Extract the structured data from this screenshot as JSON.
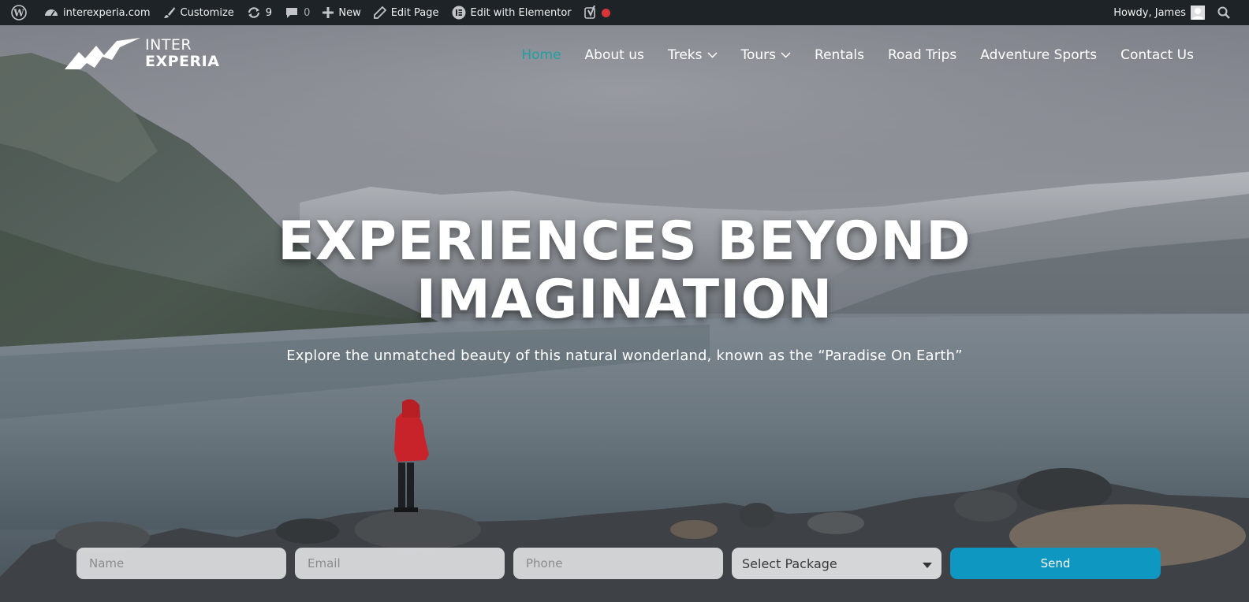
{
  "admin_bar": {
    "site_name": "interexperia.com",
    "customize": "Customize",
    "updates_count": "9",
    "comments_count": "0",
    "new_label": "New",
    "edit_page": "Edit Page",
    "edit_elementor": "Edit with Elementor",
    "greeting": "Howdy, James",
    "icons": [
      "wordpress-icon",
      "dashboard-icon",
      "brush-icon",
      "refresh-icon",
      "comment-icon",
      "plus-icon",
      "pencil-icon",
      "elementor-icon",
      "yoast-icon",
      "status-dot-icon",
      "avatar",
      "search-icon"
    ],
    "status_color": "#d63638"
  },
  "brand": {
    "line1": "INTER",
    "line2": "EXPERIA"
  },
  "nav": {
    "items": [
      {
        "label": "Home",
        "active": true
      },
      {
        "label": "About us"
      },
      {
        "label": "Treks",
        "dropdown": true
      },
      {
        "label": "Tours",
        "dropdown": true
      },
      {
        "label": "Rentals"
      },
      {
        "label": "Road Trips"
      },
      {
        "label": "Adventure Sports"
      },
      {
        "label": "Contact Us"
      }
    ],
    "active_color": "#1fa0a6"
  },
  "hero": {
    "title_line1": "EXPERIENCES BEYOND",
    "title_line2": "IMAGINATION",
    "subtitle": "Explore the unmatched beauty of this natural wonderland, known as the “Paradise On Earth”"
  },
  "form": {
    "name_placeholder": "Name",
    "email_placeholder": "Email",
    "phone_placeholder": "Phone",
    "package_selected": "Select Package",
    "send_label": "Send",
    "send_color": "#0d97c1"
  }
}
